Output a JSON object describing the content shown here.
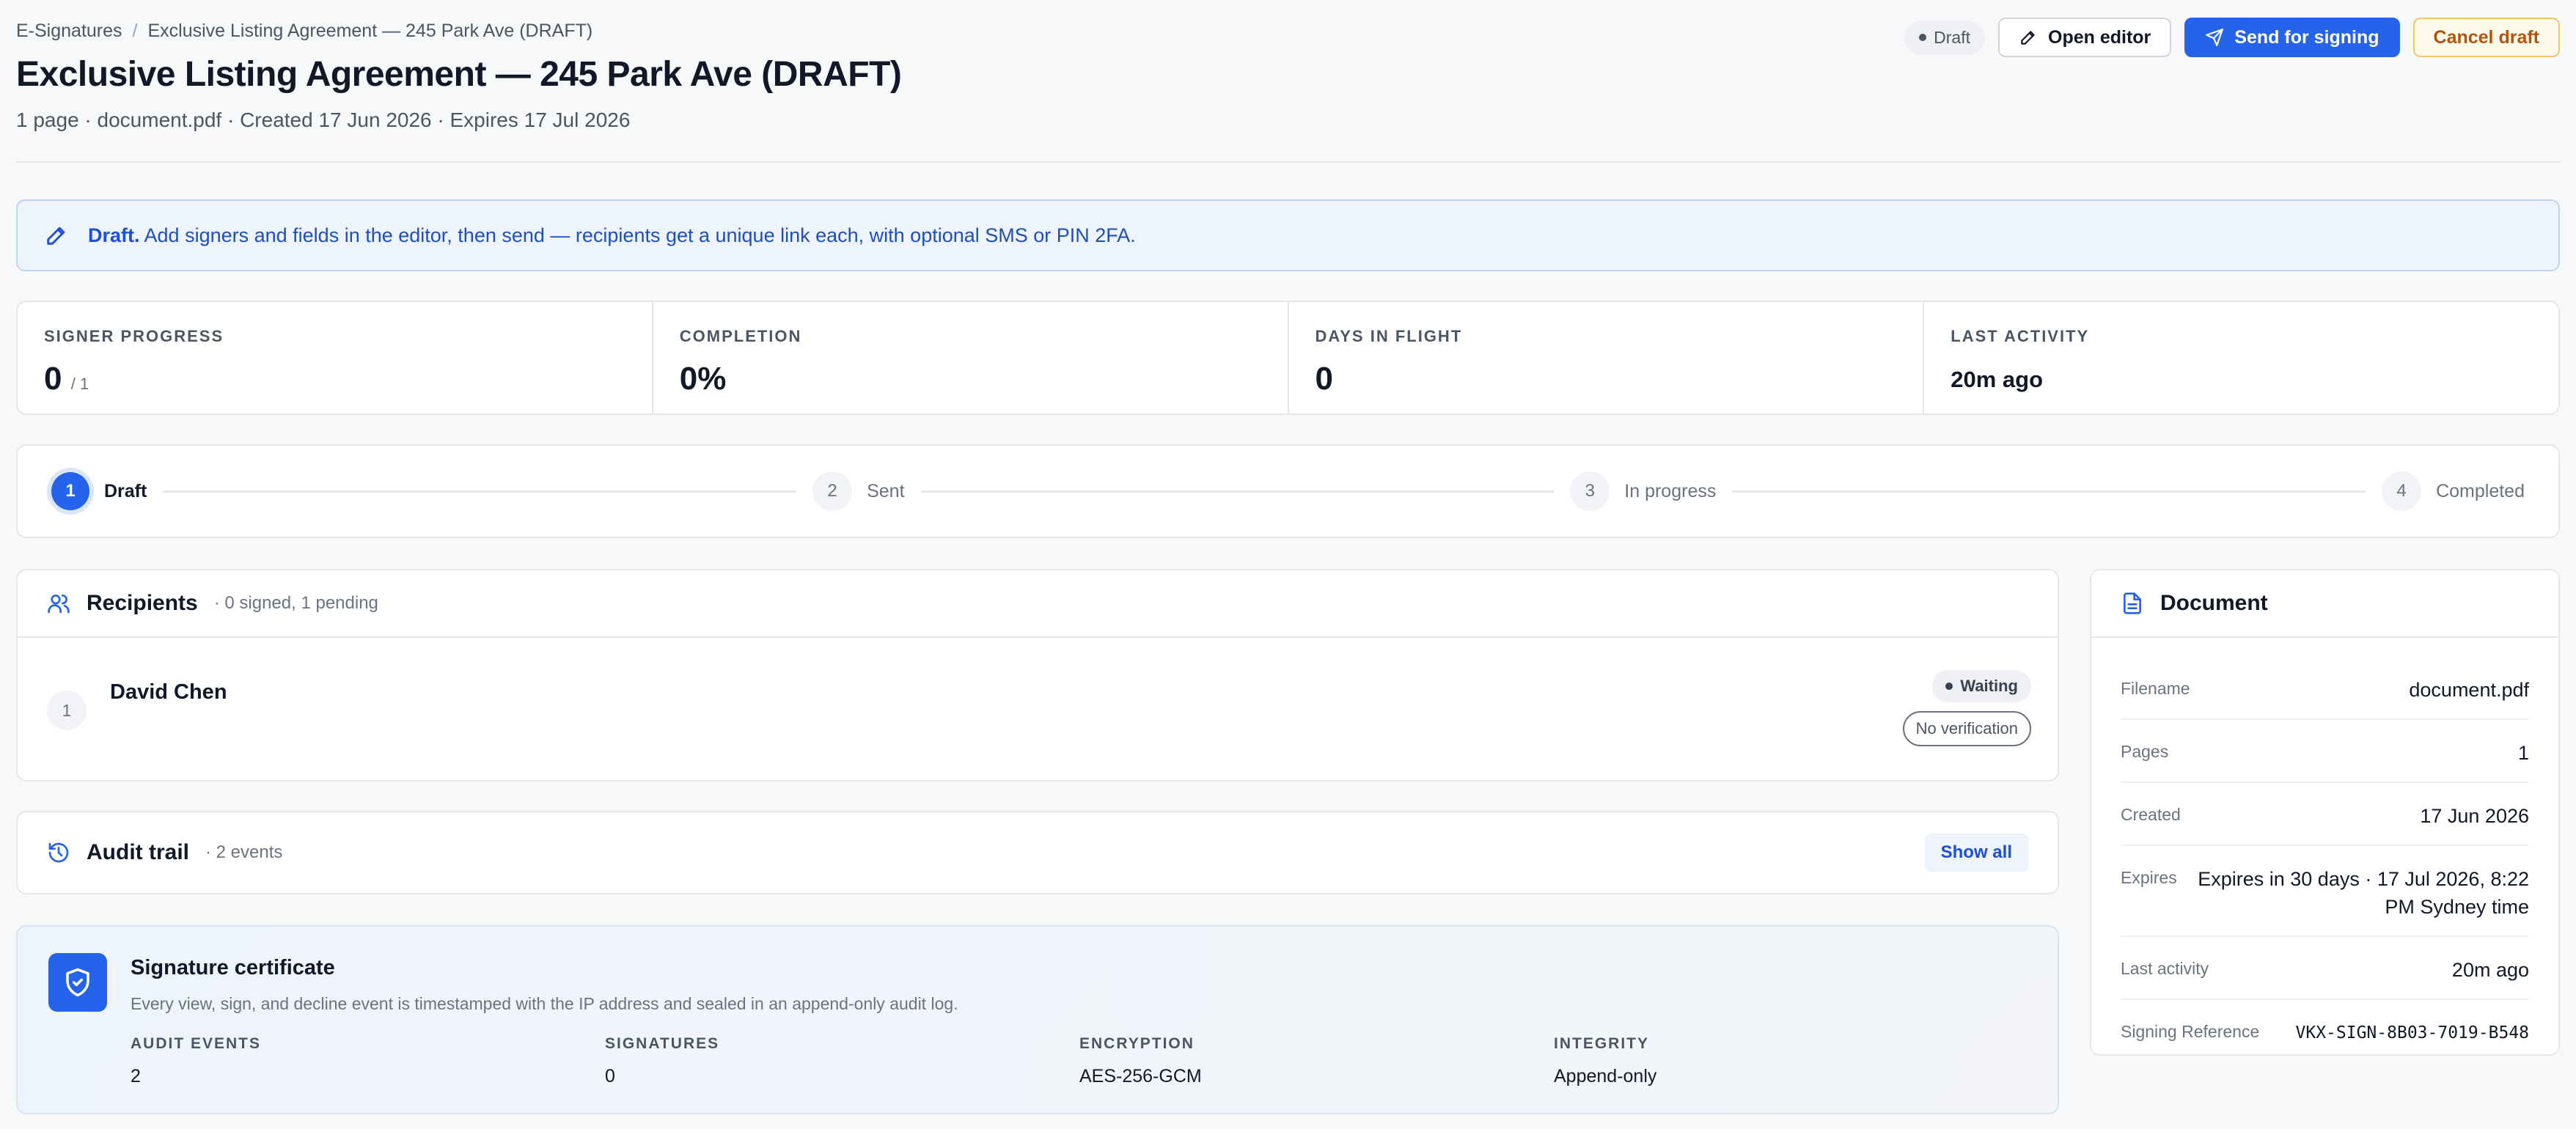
{
  "breadcrumb": {
    "root": "E-Signatures",
    "separator": "/",
    "current": "Exclusive Listing Agreement — 245 Park Ave (DRAFT)"
  },
  "header": {
    "title": "Exclusive Listing Agreement — 245 Park Ave (DRAFT)",
    "meta": "1 page · document.pdf · Created 17 Jun 2026 · Expires 17 Jul 2026",
    "status_pill": "Draft",
    "open_editor": "Open editor",
    "send_for_signing": "Send for signing",
    "cancel_draft": "Cancel draft"
  },
  "banner": {
    "strong": "Draft.",
    "text": "Add signers and fields in the editor, then send — recipients get a unique link each, with optional SMS or PIN 2FA."
  },
  "stats": [
    {
      "label": "Signer progress",
      "value": "0",
      "sub": "/ 1"
    },
    {
      "label": "Completion",
      "value": "0%"
    },
    {
      "label": "Days in flight",
      "value": "0"
    },
    {
      "label": "Last activity",
      "value": "20m ago"
    }
  ],
  "steps": [
    {
      "num": "1",
      "label": "Draft"
    },
    {
      "num": "2",
      "label": "Sent"
    },
    {
      "num": "3",
      "label": "In progress"
    },
    {
      "num": "4",
      "label": "Completed"
    }
  ],
  "recipients": {
    "title": "Recipients",
    "summary": "· 0 signed, 1 pending",
    "items": [
      {
        "num": "1",
        "name": "David Chen",
        "status": "Waiting",
        "verification": "No verification"
      }
    ]
  },
  "audit": {
    "title": "Audit trail",
    "summary": "· 2 events",
    "show_all": "Show all"
  },
  "certificate": {
    "title": "Signature certificate",
    "description": "Every view, sign, and decline event is timestamped with the IP address and sealed in an append-only audit log.",
    "stats": [
      {
        "label": "Audit events",
        "value": "2"
      },
      {
        "label": "Signatures",
        "value": "0"
      },
      {
        "label": "Encryption",
        "value": "AES-256-GCM"
      },
      {
        "label": "Integrity",
        "value": "Append-only"
      }
    ]
  },
  "document": {
    "title": "Document",
    "rows": [
      {
        "key": "Filename",
        "value": "document.pdf"
      },
      {
        "key": "Pages",
        "value": "1"
      },
      {
        "key": "Created",
        "value": "17 Jun 2026"
      },
      {
        "key": "Expires",
        "value": "Expires in 30 days · 17 Jul 2026, 8:22 PM Sydney time"
      },
      {
        "key": "Last activity",
        "value": "20m ago"
      },
      {
        "key": "Signing Reference",
        "value": "VKX-SIGN-8B03-7019-B548"
      }
    ]
  },
  "colors": {
    "accent": "#2563eb",
    "warning": "#b45309",
    "banner_bg": "#eef4fd"
  }
}
